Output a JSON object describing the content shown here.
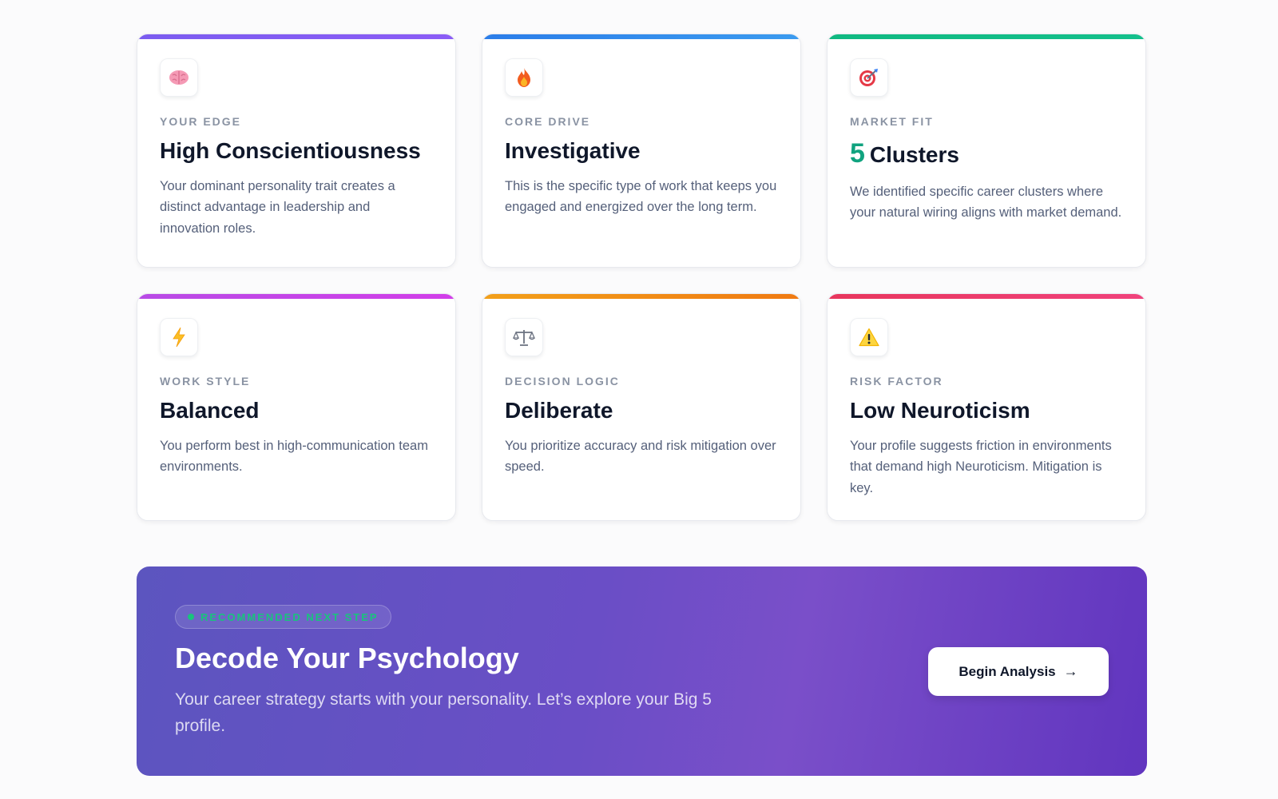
{
  "cards": [
    {
      "eyebrow": "YOUR EDGE",
      "title": "High Conscientiousness",
      "description": "Your dominant personality trait creates a distinct advantage in leadership and innovation roles.",
      "icon": "brain-icon",
      "accent": "#7b5cf0"
    },
    {
      "eyebrow": "CORE DRIVE",
      "title": "Investigative",
      "description": "This is the specific type of work that keeps you engaged and energized over the long term.",
      "icon": "fire-icon",
      "accent": "#2f86eb"
    },
    {
      "eyebrow": "MARKET FIT",
      "title_number": "5",
      "title": "Clusters",
      "description": "We identified specific career clusters where your natural wiring aligns with market demand.",
      "icon": "target-icon",
      "accent": "#10b981"
    },
    {
      "eyebrow": "WORK STYLE",
      "title": "Balanced",
      "description": "You perform best in high-communication team environments.",
      "icon": "lightning-icon",
      "accent": "#c044e8"
    },
    {
      "eyebrow": "DECISION LOGIC",
      "title": "Deliberate",
      "description": "You prioritize accuracy and risk mitigation over speed.",
      "icon": "scales-icon",
      "accent": "#f28a1a"
    },
    {
      "eyebrow": "RISK FACTOR",
      "title": "Low Neuroticism",
      "description": "Your profile suggests friction in environments that demand high Neuroticism. Mitigation is key.",
      "icon": "warning-icon",
      "accent": "#ec3a6e"
    }
  ],
  "cta": {
    "badge": "RECOMMENDED NEXT STEP",
    "title": "Decode Your Psychology",
    "description": "Your career strategy starts with your personality. Let’s explore your Big 5 profile.",
    "button_label": "Begin Analysis",
    "button_arrow": "→"
  }
}
